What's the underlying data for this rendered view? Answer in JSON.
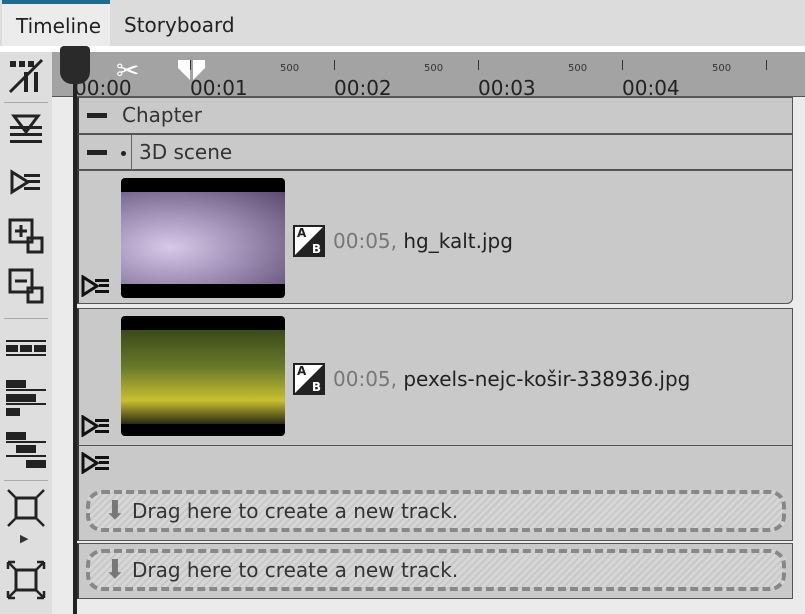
{
  "tabs": [
    {
      "label": "Timeline",
      "active": true
    },
    {
      "label": "Storyboard",
      "active": false
    }
  ],
  "accent": "#1a6e96",
  "toolbar": {
    "icons": [
      "snap-markers-icon",
      "insert-marker-icon",
      "track-icon",
      "add-track-icon",
      "remove-track-icon",
      "filmstrip-icon",
      "align-left-icon",
      "align-center-icon",
      "fit-collapse-icon",
      "fit-expand-icon"
    ]
  },
  "ruler": {
    "time_labels": [
      "00:00",
      "00:01",
      "00:02",
      "00:03",
      "00:04"
    ],
    "ms_labels": [
      "500",
      "500",
      "500",
      "500"
    ]
  },
  "rows": {
    "chapter": "Chapter",
    "scene": "3D scene"
  },
  "clips": [
    {
      "duration": "00:05,",
      "filename": "hg_kalt.jpg"
    },
    {
      "duration": "00:05,",
      "filename": "pexels-nejc-košir-338936.jpg"
    }
  ],
  "transition_labels": {
    "a": "A",
    "b": "B"
  },
  "drop_zone": "Drag here to create a new track."
}
